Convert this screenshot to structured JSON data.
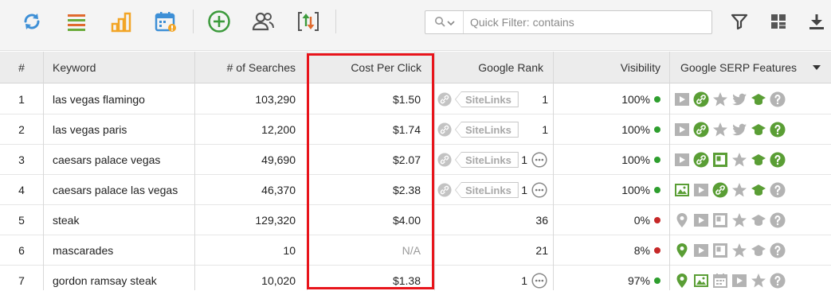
{
  "toolbar": {
    "icons": [
      "refresh-icon",
      "list-icon",
      "bar-chart-icon",
      "calendar-alert-icon",
      "add-circle-icon",
      "users-icon",
      "sort-arrows-icon"
    ],
    "filter_placeholder": "Quick Filter: contains",
    "right_icons": [
      "filter-icon",
      "layout-icon",
      "download-icon"
    ]
  },
  "columns": {
    "num": "#",
    "keyword": "Keyword",
    "searches": "# of Searches",
    "cpc": "Cost Per Click",
    "rank": "Google Rank",
    "visibility": "Visibility",
    "serp": "Google SERP Features"
  },
  "sitelinks_label": "SiteLinks",
  "rows": [
    {
      "num": "1",
      "keyword": "las vegas flamingo",
      "searches": "103,290",
      "cpc": "$1.50",
      "rank": "1",
      "visibility": "100%",
      "status": "green",
      "sitelinks": true,
      "more": false,
      "features": [
        "video",
        "link-green",
        "star",
        "twitter",
        "graduation-green",
        "help"
      ]
    },
    {
      "num": "2",
      "keyword": "las vegas paris",
      "searches": "12,200",
      "cpc": "$1.74",
      "rank": "1",
      "visibility": "100%",
      "status": "green",
      "sitelinks": true,
      "more": false,
      "features": [
        "video",
        "link-green",
        "star",
        "twitter",
        "graduation-green",
        "help-green"
      ]
    },
    {
      "num": "3",
      "keyword": "caesars palace vegas",
      "searches": "49,690",
      "cpc": "$2.07",
      "rank": "1",
      "visibility": "100%",
      "status": "green",
      "sitelinks": true,
      "more": true,
      "features": [
        "video",
        "link-green",
        "panel-green",
        "star",
        "graduation-green",
        "help-green"
      ]
    },
    {
      "num": "4",
      "keyword": "caesars palace las vegas",
      "searches": "46,370",
      "cpc": "$2.38",
      "rank": "1",
      "visibility": "100%",
      "status": "green",
      "sitelinks": true,
      "more": true,
      "features": [
        "image-green",
        "video",
        "link-green",
        "star",
        "graduation-green",
        "help"
      ]
    },
    {
      "num": "5",
      "keyword": "steak",
      "searches": "129,320",
      "cpc": "$4.00",
      "rank": "36",
      "visibility": "0%",
      "status": "red",
      "sitelinks": false,
      "more": false,
      "features": [
        "pin",
        "video",
        "panel",
        "star",
        "graduation",
        "help"
      ]
    },
    {
      "num": "6",
      "keyword": "mascarades",
      "searches": "10",
      "cpc": "N/A",
      "rank": "21",
      "visibility": "8%",
      "status": "red",
      "sitelinks": false,
      "more": false,
      "features": [
        "pin-green",
        "video",
        "panel",
        "star",
        "graduation",
        "help"
      ]
    },
    {
      "num": "7",
      "keyword": "gordon ramsay steak",
      "searches": "10,020",
      "cpc": "$1.38",
      "rank": "1",
      "visibility": "97%",
      "status": "green",
      "sitelinks": false,
      "more": true,
      "features": [
        "pin-green",
        "image-green",
        "calendar",
        "video",
        "star",
        "help"
      ]
    }
  ],
  "colors": {
    "green": "#2e9e2e",
    "red": "#c62828",
    "gray_icon": "#b3b3b3",
    "feature_green": "#5a9e35",
    "highlight": "#e8141b"
  }
}
